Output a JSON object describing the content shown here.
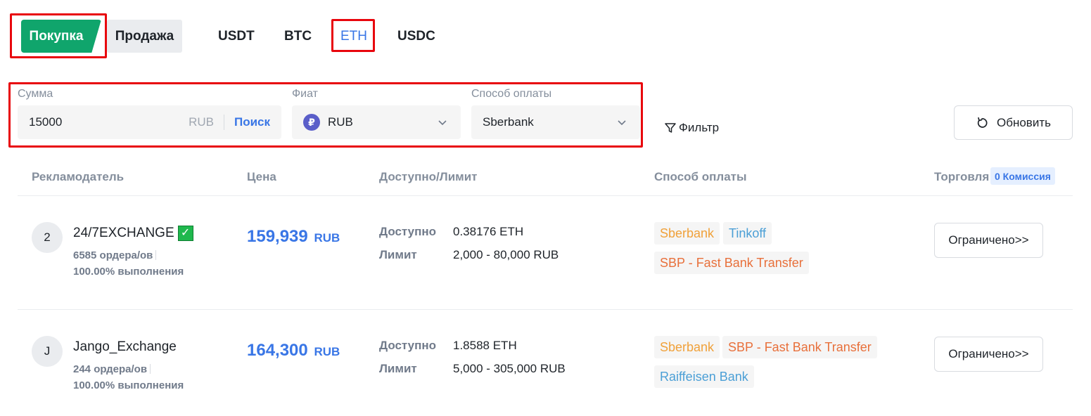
{
  "trade_type": {
    "buy_label": "Покупка",
    "sell_label": "Продажа"
  },
  "coins": [
    {
      "label": "USDT",
      "active": false
    },
    {
      "label": "BTC",
      "active": false
    },
    {
      "label": "ETH",
      "active": true
    },
    {
      "label": "USDC",
      "active": false
    }
  ],
  "filters": {
    "amount": {
      "label": "Сумма",
      "value": "15000",
      "unit": "RUB",
      "search_label": "Поиск"
    },
    "fiat": {
      "label": "Фиат",
      "icon_glyph": "₽",
      "value": "RUB"
    },
    "payment": {
      "label": "Способ оплаты",
      "value": "Sberbank"
    },
    "filter_label": "Фильтр",
    "refresh_label": "Обновить"
  },
  "table": {
    "headers": {
      "advertiser": "Рекламодатель",
      "price": "Цена",
      "available": "Доступно/Лимит",
      "payment": "Способ оплаты",
      "trade": "Торговля",
      "fee_badge": "0 Комиссия"
    },
    "rows": [
      {
        "avatar": "2",
        "name": "24/7EXCHANGE",
        "verified": true,
        "verified_glyph": "✓",
        "orders": "6585 ордера/ов",
        "completion": "100.00% выполнения",
        "price": "159,939",
        "price_currency": "RUB",
        "available_label": "Доступно",
        "available_value": "0.38176 ETH",
        "limit_label": "Лимит",
        "limit_value": "2,000 - 80,000 RUB",
        "payments": [
          {
            "label": "Sberbank",
            "color": "#f0a13a"
          },
          {
            "label": "Tinkoff",
            "color": "#4b9fd6"
          },
          {
            "label": "SBP - Fast Bank Transfer",
            "color": "#e8703b"
          }
        ],
        "trade_label": "Ограничено>>"
      },
      {
        "avatar": "J",
        "name": "Jango_Exchange",
        "verified": false,
        "orders": "244 ордера/ов",
        "completion": "100.00% выполнения",
        "price": "164,300",
        "price_currency": "RUB",
        "available_label": "Доступно",
        "available_value": "1.8588 ETH",
        "limit_label": "Лимит",
        "limit_value": "5,000 - 305,000 RUB",
        "payments": [
          {
            "label": "Sberbank",
            "color": "#f0a13a"
          },
          {
            "label": "SBP - Fast Bank Transfer",
            "color": "#e8703b"
          },
          {
            "label": "Raiffeisen Bank",
            "color": "#4b9fd6"
          }
        ],
        "trade_label": "Ограничено>>"
      }
    ]
  },
  "colors": {
    "buy_green": "#10a56c",
    "accent_blue": "#3976e6",
    "highlight_red": "#e8060d"
  }
}
